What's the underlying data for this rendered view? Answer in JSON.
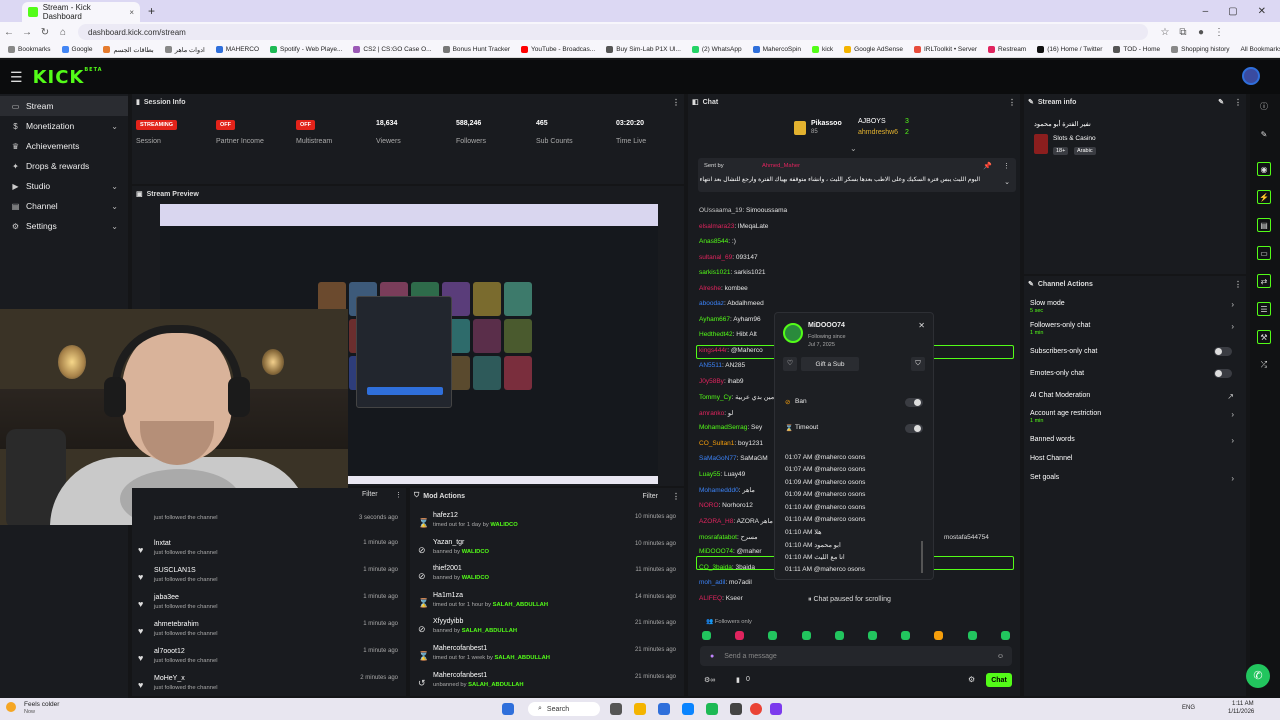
{
  "browser": {
    "tab_title": "Stream - Kick Dashboard",
    "tab_close": "×",
    "new_tab": "+",
    "url": "dashboard.kick.com/stream",
    "all_bookmarks": "All Bookmarks",
    "bookmarks": [
      "Bookmarks",
      "Google",
      "بطاقات الجسم",
      "ادوات ماهر",
      "MAHERCO",
      "Spotify - Web Playe...",
      "CS2 | CS:GO Case O...",
      "Bonus Hunt Tracker",
      "YouTube - Broadcas...",
      "Buy Sim-Lab P1X Ul...",
      "(2) WhatsApp",
      "MahercoSpin",
      "kick",
      "Google AdSense",
      "IRLToolkit • Server",
      "Restream",
      "(16) Home / Twitter",
      "TOD - Home",
      "Shopping history"
    ],
    "bookmark_colors": [
      "#888",
      "#4285f4",
      "#e57b2e",
      "#888",
      "#2f6fdb",
      "#1db954",
      "#9b59b6",
      "#777",
      "#ff0000",
      "#555",
      "#25d366",
      "#2f6fdb",
      "#53fc18",
      "#f4b400",
      "#e74c3c",
      "#e0245e",
      "#111",
      "#555",
      "#888"
    ]
  },
  "topbar": {
    "logo": "KICK",
    "logo_sup": "BETA"
  },
  "sidebar": {
    "items": [
      {
        "label": "Stream",
        "icon": "stream-icon",
        "active": true,
        "chevron": false
      },
      {
        "label": "Monetization",
        "icon": "money-icon",
        "active": false,
        "chevron": true
      },
      {
        "label": "Achievements",
        "icon": "trophy-icon",
        "active": false,
        "chevron": false
      },
      {
        "label": "Drops & rewards",
        "icon": "gift-icon",
        "active": false,
        "chevron": false
      },
      {
        "label": "Studio",
        "icon": "studio-icon",
        "active": false,
        "chevron": true
      },
      {
        "label": "Channel",
        "icon": "channel-icon",
        "active": false,
        "chevron": true
      },
      {
        "label": "Settings",
        "icon": "gear-icon",
        "active": false,
        "chevron": true
      }
    ]
  },
  "session": {
    "title": "Session Info",
    "metrics": [
      {
        "value": "STREAMING",
        "label": "Session",
        "pill": true
      },
      {
        "value": "OFF",
        "label": "Partner Income",
        "pill": true
      },
      {
        "value": "OFF",
        "label": "Multistream",
        "pill": true
      },
      {
        "value": "18,634",
        "label": "Viewers",
        "pill": false
      },
      {
        "value": "588,246",
        "label": "Followers",
        "pill": false
      },
      {
        "value": "465",
        "label": "Sub Counts",
        "pill": false
      },
      {
        "value": "03:20:20",
        "label": "Time Live",
        "pill": false
      }
    ]
  },
  "preview": {
    "title": "Stream Preview"
  },
  "followers_panel": {
    "filter": "Filter",
    "first_time": "3 seconds ago",
    "first_sub": "just followed the channel",
    "rows": [
      {
        "name": "lnxtat",
        "sub": "just followed the channel",
        "time": "1 minute ago"
      },
      {
        "name": "SUSCLAN1S",
        "sub": "just followed the channel",
        "time": "1 minute ago"
      },
      {
        "name": "jaba3ee",
        "sub": "just followed the channel",
        "time": "1 minute ago"
      },
      {
        "name": "ahmetebrahim",
        "sub": "just followed the channel",
        "time": "1 minute ago"
      },
      {
        "name": "al7ooot12",
        "sub": "just followed the channel",
        "time": "1 minute ago"
      },
      {
        "name": "MoHeY_x",
        "sub": "just followed the channel",
        "time": "2 minutes ago"
      }
    ]
  },
  "mod_actions": {
    "title": "Mod Actions",
    "filter": "Filter",
    "rows": [
      {
        "icon": "hourglass-icon",
        "glyph": "⌛",
        "name": "hafez12",
        "sub": "timed out for 1 day by ",
        "by": "WALIDCO",
        "time": "10 minutes ago"
      },
      {
        "icon": "ban-icon",
        "glyph": "⊘",
        "name": "Yazan_tgr",
        "sub": "banned by ",
        "by": "WALIDCO",
        "time": "10 minutes ago"
      },
      {
        "icon": "ban-icon",
        "glyph": "⊘",
        "name": "thief2001",
        "sub": "banned by ",
        "by": "WALIDCO",
        "time": "11 minutes ago"
      },
      {
        "icon": "hourglass-icon",
        "glyph": "⌛",
        "name": "Ha1m1za",
        "sub": "timed out for 1 hour by ",
        "by": "SALAH_ABDULLAH",
        "time": "14 minutes ago"
      },
      {
        "icon": "ban-icon",
        "glyph": "⊘",
        "name": "Xfyydyibb",
        "sub": "banned by ",
        "by": "SALAH_ABDULLAH",
        "time": "21 minutes ago"
      },
      {
        "icon": "hourglass-icon",
        "glyph": "⌛",
        "name": "Mahercofanbest1",
        "sub": "timed out for 1 week by ",
        "by": "SALAH_ABDULLAH",
        "time": "21 minutes ago"
      },
      {
        "icon": "unban-icon",
        "glyph": "↺",
        "name": "Mahercofanbest1",
        "sub": "unbanned by ",
        "by": "SALAH_ABDULLAH",
        "time": "21 minutes ago"
      }
    ]
  },
  "chat": {
    "title": "Chat",
    "leaders": [
      {
        "name": "Pikassoo",
        "count": "85"
      },
      {
        "name": "AJBOYS",
        "count": "3"
      },
      {
        "name": "ahmdreshw6",
        "count": "2"
      }
    ],
    "pinned": {
      "sent_by": "Sent by",
      "user": "Ahmed_Maher",
      "text": "اليوم الليث يبس فترة السكيك وعلى الاطب بعدها بسكر الليث ، وانشاء متوقفة بهياك الفترة وارجع للتشال بعد انتهاء الفترة"
    },
    "messages": [
      {
        "user": "OUssaama_19",
        "color": "#c9c9c9",
        "text": "Simooussama"
      },
      {
        "user": "elsalmara23",
        "color": "#e0245e",
        "text": "lMeqaLate"
      },
      {
        "user": "Anas8544",
        "color": "#53fc18",
        "text": ":) "
      },
      {
        "user": "sultanal_69",
        "color": "#e0245e",
        "text": "093147"
      },
      {
        "user": "sarkis1021",
        "color": "#53fc18",
        "text": "sarkis1021"
      },
      {
        "user": "Alreshe",
        "color": "#e0245e",
        "text": "kombee"
      },
      {
        "user": "aboodaz",
        "color": "#3b82f6",
        "text": "Abdalhmeed"
      },
      {
        "user": "Ayham667",
        "color": "#53fc18",
        "text": "Ayham96"
      },
      {
        "user": "Hedthedt42",
        "color": "#53fc18",
        "text": "Hibt Alt"
      },
      {
        "user": "kings444r",
        "color": "#e0245e",
        "text": "@Maherco"
      },
      {
        "user": "AN5511",
        "color": "#3b82f6",
        "text": "AN285"
      },
      {
        "user": "J0y58By",
        "color": "#e0245e",
        "text": "ihab9"
      },
      {
        "user": "Tommy_Cy",
        "color": "#53fc18",
        "text": "مين بدي عربية"
      },
      {
        "user": "amranko",
        "color": "#e0245e",
        "text": "لو"
      },
      {
        "user": "MohamadSerrag",
        "color": "#53fc18",
        "text": "Sey"
      },
      {
        "user": "CO_Sultan1",
        "color": "#f59e0b",
        "text": "boy1231"
      },
      {
        "user": "SaMaGoN77",
        "color": "#3b82f6",
        "text": "SaMaGM"
      },
      {
        "user": "Luay55",
        "color": "#53fc18",
        "text": "Luay49"
      },
      {
        "user": "Mohameddd0",
        "color": "#3b82f6",
        "text": "ماهر"
      },
      {
        "user": "NORO",
        "color": "#e0245e",
        "text": "Norhoro12"
      },
      {
        "user": "AZORA_H8",
        "color": "#e0245e",
        "text": "AZORA ماهر"
      },
      {
        "user": "mosrafatabot",
        "color": "#53fc18",
        "text": "مسرح"
      },
      {
        "user": "MiDOOO74",
        "color": "#53fc18",
        "text": "@maher"
      },
      {
        "user": "CO_3baida",
        "color": "#53fc18",
        "text": "3baida"
      },
      {
        "user": "moh_adil",
        "color": "#3b82f6",
        "text": "mo7adil"
      },
      {
        "user": "ALIFEQ",
        "color": "#e0245e",
        "text": "Kseer"
      }
    ],
    "right_msg": "mostafa544754",
    "popup": {
      "name": "MiDOOO74",
      "following_since": "Following since",
      "date": "Jul 7, 2025",
      "gift": "Gift a Sub",
      "ban": "Ban",
      "timeout": "Timeout",
      "history": [
        {
          "t": "01:07 AM",
          "m": "@maherco osons"
        },
        {
          "t": "01:07 AM",
          "m": "@maherco osons"
        },
        {
          "t": "01:09 AM",
          "m": "@maherco osons"
        },
        {
          "t": "01:09 AM",
          "m": "@maherco osons"
        },
        {
          "t": "01:10 AM",
          "m": "@maherco osons"
        },
        {
          "t": "01:10 AM",
          "m": "@maherco osons"
        },
        {
          "t": "01:10 AM",
          "m": "هلا"
        },
        {
          "t": "01:10 AM",
          "m": "ابو محمود"
        },
        {
          "t": "01:10 AM",
          "m": "انا مع الليث"
        },
        {
          "t": "01:11 AM",
          "m": "@maherco osons"
        }
      ]
    },
    "paused": "Chat paused for scrolling",
    "followers_only": "Followers only",
    "placeholder": "Send a message",
    "count": "0",
    "send": "Chat"
  },
  "stream_info": {
    "title": "Stream info",
    "stream_title": "نفير الفترة أبو محمود",
    "category": "Slots & Casino",
    "tags": [
      "18+",
      "Arabic"
    ]
  },
  "channel_actions": {
    "title": "Channel Actions",
    "rows": [
      {
        "label": "Slow mode",
        "sub": "5 sec",
        "control": "chevron"
      },
      {
        "label": "Followers-only chat",
        "sub": "1 min",
        "control": "chevron"
      },
      {
        "label": "Subscribers-only chat",
        "sub": "",
        "control": "toggle"
      },
      {
        "label": "Emotes-only chat",
        "sub": "",
        "control": "toggle"
      },
      {
        "label": "AI Chat Moderation",
        "sub": "",
        "control": "external"
      },
      {
        "label": "Account age restriction",
        "sub": "1 min",
        "control": "chevron"
      },
      {
        "label": "Banned words",
        "sub": "",
        "control": "chevron"
      },
      {
        "label": "Host Channel",
        "sub": "",
        "control": "none"
      },
      {
        "label": "Set goals",
        "sub": "",
        "control": "chevron"
      }
    ]
  },
  "taskbar": {
    "weather_title": "Feels colder",
    "weather_sub": "Now",
    "search": "Search",
    "lang": "ENG",
    "time": "1:11 AM",
    "date": "1/11/2026"
  }
}
